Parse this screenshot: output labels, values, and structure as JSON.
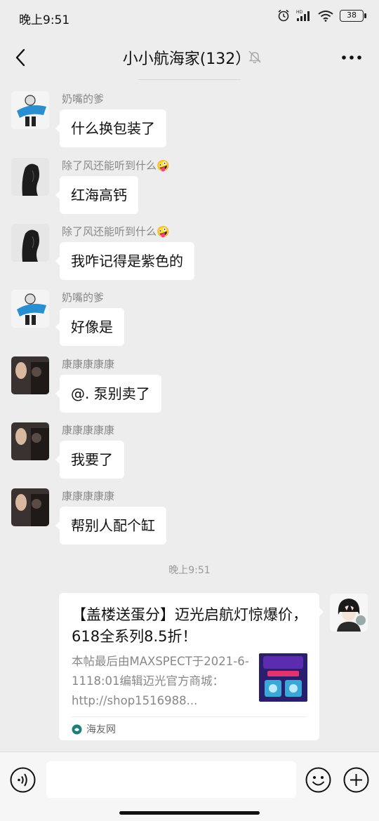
{
  "status_bar": {
    "time": "晚上9:51",
    "battery": "38",
    "icons": [
      "alarm-icon",
      "hd-signal-icon",
      "wifi-icon",
      "battery-icon"
    ]
  },
  "header": {
    "title": "小小航海家(132）",
    "back_icon": "chevron-left-icon",
    "mute_icon": "bell-muted-icon",
    "more_icon": "more-dots-icon"
  },
  "messages": [
    {
      "sender": "奶嘴的爹",
      "text": "什么换包装了"
    },
    {
      "sender": "除了风还能听到什么🤪",
      "text": "红海高钙"
    },
    {
      "sender": "除了风还能听到什么🤪",
      "text": "我咋记得是紫色的"
    },
    {
      "sender": "奶嘴的爹",
      "text": "好像是"
    },
    {
      "sender": "康康康康康",
      "text": "@. 泵别卖了"
    },
    {
      "sender": "康康康康康",
      "text": "我要了"
    },
    {
      "sender": "康康康康康",
      "text": "帮别人配个缸"
    }
  ],
  "timestamp": "晚上9:51",
  "link_card": {
    "title": "【盖楼送蛋分】迈光启航灯惊爆价，618全系列8.5折！",
    "description": "本帖最后由MAXSPECT于2021-6-1118:01编辑迈光官方商城：http://shop1516988...",
    "source": "海友网"
  },
  "bottom_bar": {
    "voice_icon": "voice-icon",
    "emoji_icon": "emoji-icon",
    "plus_icon": "plus-icon"
  },
  "colors": {
    "background": "#ededed",
    "bubble": "#ffffff",
    "secondary_text": "#888888"
  }
}
